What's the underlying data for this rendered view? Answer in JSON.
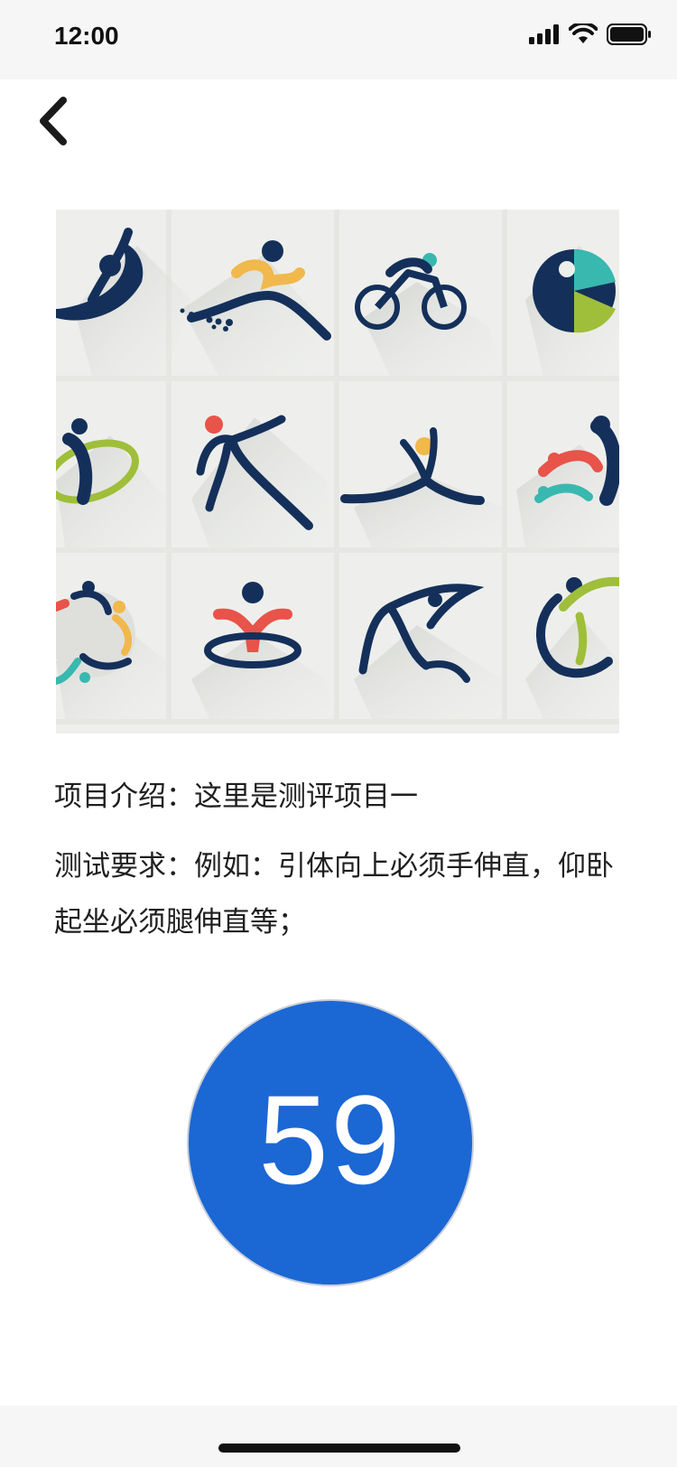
{
  "status_bar": {
    "time": "12:00",
    "icons": [
      "signal-icon",
      "wifi-icon",
      "battery-icon"
    ]
  },
  "nav": {
    "back_icon": "chevron-left-icon"
  },
  "hero": {
    "icons": [
      "yoga-icon",
      "running-icon",
      "cycling-icon",
      "stretch-icon",
      "ring-gymnast-icon",
      "leaping-icon",
      "floor-gymnast-icon",
      "group-dance-icon",
      "team-circle-icon",
      "swimming-icon",
      "dancer-icon",
      "crescent-athlete-icon"
    ]
  },
  "content": {
    "intro": "项目介绍：这里是测评项目一",
    "requirements": "测试要求：例如：引体向上必须手伸直，仰卧起坐必须腿伸直等；"
  },
  "score": {
    "value": "59"
  },
  "colors": {
    "score_circle": "#1b67d4",
    "navy": "#14305a",
    "orange": "#f1b84b",
    "teal": "#39b8b0",
    "green": "#9fbe3a",
    "red": "#e8534a"
  }
}
